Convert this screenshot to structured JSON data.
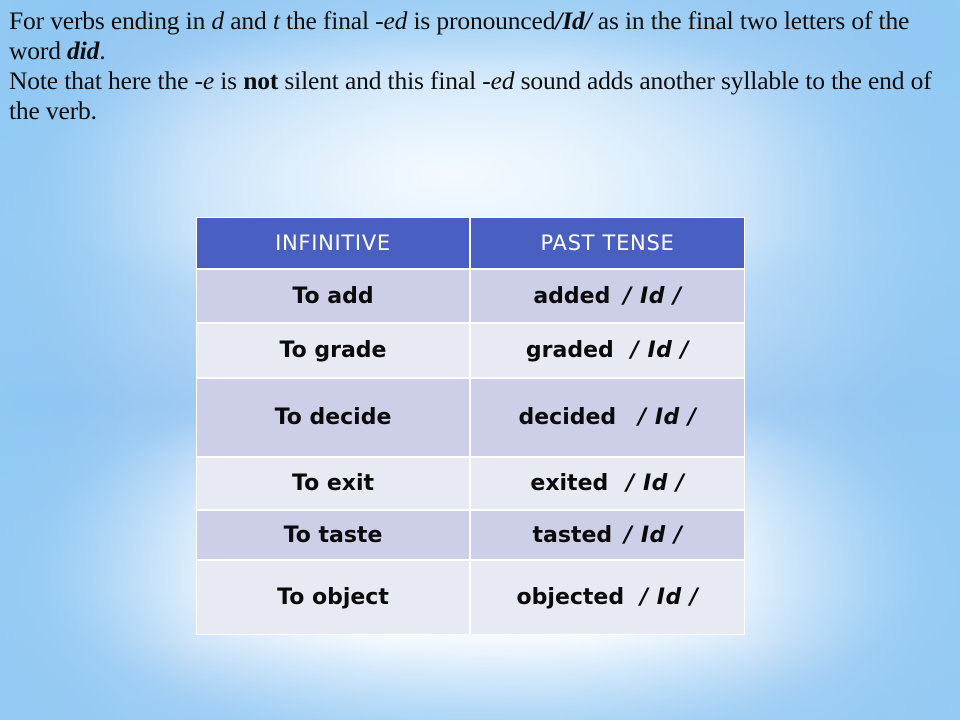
{
  "slide": {
    "background_top_color": "#b9dcf7",
    "background_center_color": "#f4fafe",
    "background_edge_color": "#9fd0f4"
  },
  "prose": {
    "line1_part1": "For verbs ending in ",
    "line1_d": "d",
    "line1_part2": " and ",
    "line1_t": "t",
    "line1_part3": " the final ",
    "line1_ed": "-ed",
    "line1_part4": " is pronounced",
    "line1_phonetic": "/Id/",
    "line1_part5": " as in the final two letters of the word ",
    "line1_did": "did",
    "line1_part6": ".",
    "line2_part1": "Note that here the ",
    "line2_e": "-e",
    "line2_part2": " is ",
    "line2_not": "not",
    "line2_part3": " silent and this final ",
    "line2_ed": "-ed",
    "line2_part4": " sound adds another syllable to the end of the verb."
  },
  "table": {
    "accent_header_bg": "#4a5fc2",
    "header_text_color": "#ffffff",
    "row_alt_dark": "#cdcfe8",
    "row_alt_light": "#e7eaf3",
    "headers": [
      "INFINITIVE",
      "PAST TENSE"
    ],
    "rows": [
      {
        "infinitive": "To add",
        "past": "added",
        "phonetic": "/ Id /"
      },
      {
        "infinitive": "To grade",
        "past": "graded",
        "phonetic": "/ Id /"
      },
      {
        "infinitive": "To decide",
        "past": "decided",
        "phonetic": "/ Id /"
      },
      {
        "infinitive": "To exit",
        "past": "exited",
        "phonetic": "/ Id /"
      },
      {
        "infinitive": "To taste",
        "past": "tasted",
        "phonetic": "/ Id /"
      },
      {
        "infinitive": "To object",
        "past": "objected",
        "phonetic": "/ Id /"
      }
    ]
  }
}
